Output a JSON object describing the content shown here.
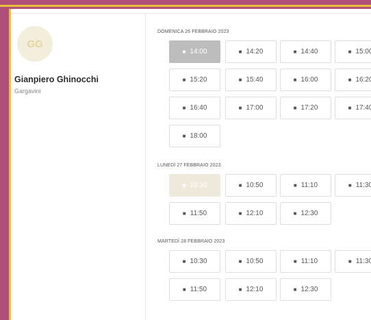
{
  "doctor": {
    "initials": "GG",
    "name": "Gianpiero Ghinocchi",
    "location": "Gargavini"
  },
  "days": [
    {
      "label": "DOMENICA 26 FEBBRAIO 2023",
      "slots": [
        {
          "time": "14:00",
          "state": "selected"
        },
        {
          "time": "14:20",
          "state": "available"
        },
        {
          "time": "14:40",
          "state": "available"
        },
        {
          "time": "15:00",
          "state": "available"
        },
        {
          "time": "15:20",
          "state": "available"
        },
        {
          "time": "15:40",
          "state": "available"
        },
        {
          "time": "16:00",
          "state": "available"
        },
        {
          "time": "16:20",
          "state": "available"
        },
        {
          "time": "16:40",
          "state": "available"
        },
        {
          "time": "17:00",
          "state": "available"
        },
        {
          "time": "17:20",
          "state": "available"
        },
        {
          "time": "17:40",
          "state": "available"
        },
        {
          "time": "18:00",
          "state": "available"
        }
      ]
    },
    {
      "label": "LUNEDÌ 27 FEBBRAIO 2023",
      "slots": [
        {
          "time": "10:30",
          "state": "disabled"
        },
        {
          "time": "10:50",
          "state": "available"
        },
        {
          "time": "11:10",
          "state": "available"
        },
        {
          "time": "11:30",
          "state": "available"
        },
        {
          "time": "11:50",
          "state": "available"
        },
        {
          "time": "12:10",
          "state": "available"
        },
        {
          "time": "12:30",
          "state": "available"
        }
      ]
    },
    {
      "label": "MARTEDÌ 28 FEBBRAIO 2023",
      "slots": [
        {
          "time": "10:30",
          "state": "available"
        },
        {
          "time": "10:50",
          "state": "available"
        },
        {
          "time": "11:10",
          "state": "available"
        },
        {
          "time": "11:30",
          "state": "available"
        },
        {
          "time": "11:50",
          "state": "available"
        },
        {
          "time": "12:10",
          "state": "available"
        },
        {
          "time": "12:30",
          "state": "available"
        }
      ]
    }
  ],
  "colors": {
    "frame": "#b0507a",
    "accent": "#e9c23a",
    "selected": "#bdbdbd",
    "disabled": "#efe9db"
  },
  "icons": {
    "slot": "video-camera-icon"
  }
}
